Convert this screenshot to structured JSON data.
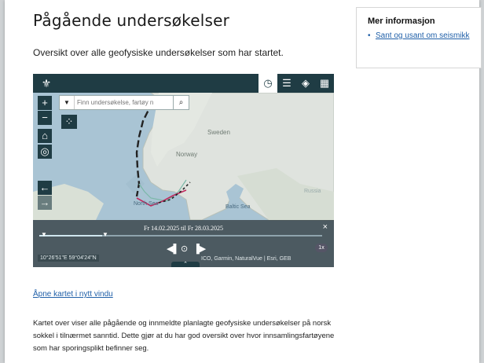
{
  "page": {
    "title": "Pågående undersøkelser",
    "subtitle": "Oversikt over alle geofysiske undersøkelser som har startet.",
    "open_map_link": "Åpne kartet i nytt vindu",
    "description": "Kartet over viser alle pågående og innmeldte planlagte geofysiske undersøkelser på norsk sokkel i tilnærmet sanntid. Dette gjør at du har god oversikt over hvor innsamlingsfartøyene som har sporingsplikt befinner seg."
  },
  "aside": {
    "heading": "Mer informasjon",
    "links": [
      "Sant og usant om seismikk"
    ]
  },
  "map": {
    "search": {
      "placeholder": "Finn undersøkelse, fartøy n"
    },
    "toolbar_icons": [
      "clock-icon",
      "list-icon",
      "layers-icon",
      "grid-icon"
    ],
    "labels": {
      "norway": "Norway",
      "sweden": "Sweden",
      "north_sea": "North Sea",
      "baltic_sea": "Baltic Sea",
      "russia": "Russia"
    },
    "time_range": "Fr 14.02.2025 til Fr 28.03.2025",
    "speed": "1x",
    "coords": "10°26'51\"E 59°04'24\"N",
    "attribution": "ICO, Garmin, NaturalVue | Esri, GEB",
    "accent": "#1f3c44"
  }
}
